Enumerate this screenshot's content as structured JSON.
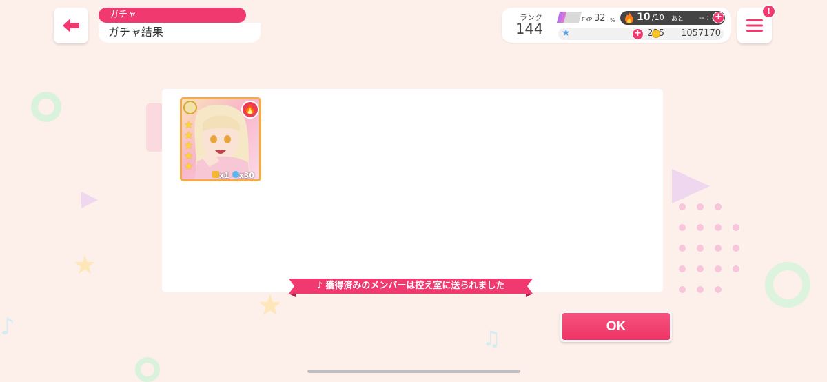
{
  "header": {
    "category": "ガチャ",
    "title": "ガチャ結果"
  },
  "status": {
    "rank_label": "ランク",
    "rank_value": "144",
    "exp_label": "EXP",
    "exp_percent": "32",
    "exp_unit": "%",
    "exp_fraction": 0.32,
    "stamina_current": "10",
    "stamina_max": "/10",
    "stamina_suffix": "あと",
    "stamina_timer": "-- : --",
    "stars": "235",
    "coins": "1057170"
  },
  "menu": {
    "badge": "!"
  },
  "result": {
    "card": {
      "rarity": 5,
      "attribute": "fire",
      "bonus_items_count": "x1",
      "bonus_stars_count": "x30"
    },
    "notice": "獲得済みのメンバーは控え室に送られました"
  },
  "ok_label": "OK",
  "colors": {
    "accent": "#f0396f",
    "background": "#fdefe9",
    "card_border": "#f4a94b"
  }
}
